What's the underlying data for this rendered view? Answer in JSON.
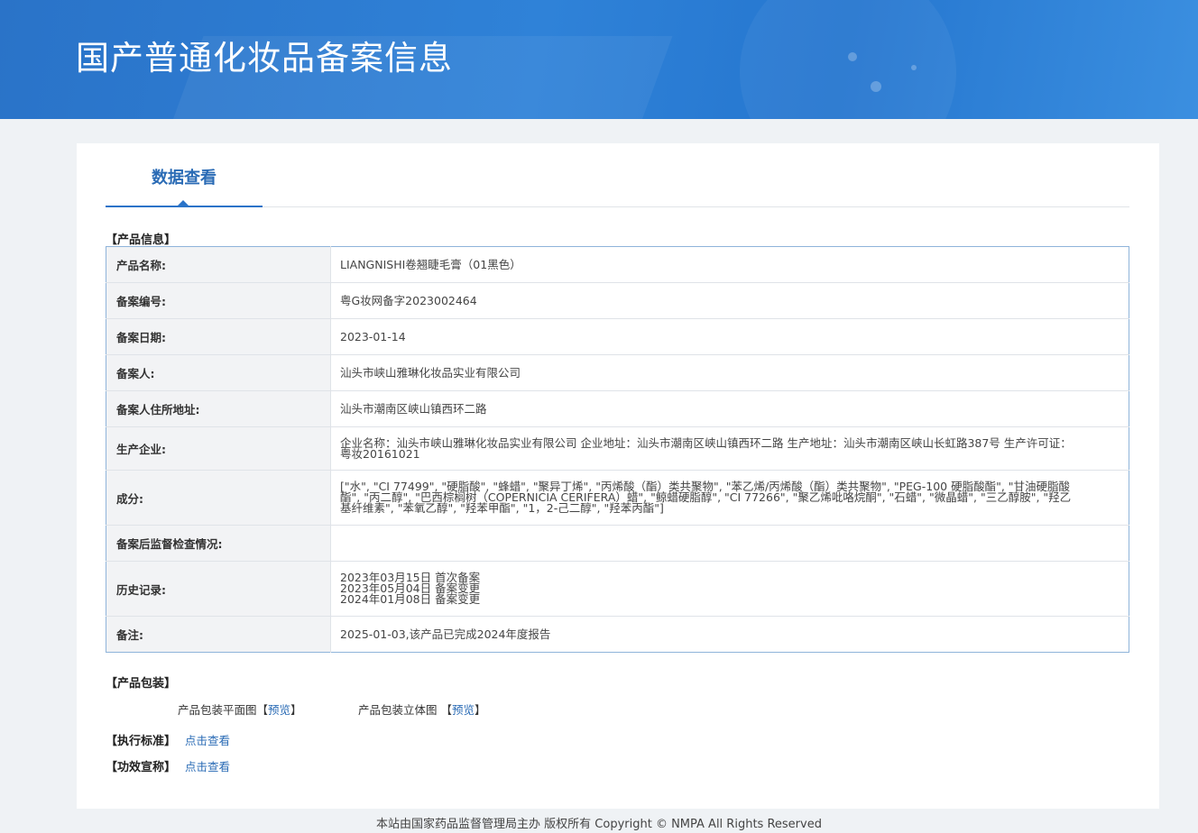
{
  "header": {
    "title": "国产普通化妆品备案信息"
  },
  "tab": {
    "label": "数据查看"
  },
  "product_info": {
    "section_label": "【产品信息】",
    "rows": [
      {
        "key": "产品名称:",
        "value": "LIANGNISHI卷翘睫毛膏（01黑色）"
      },
      {
        "key": "备案编号:",
        "value": "粤G妆网备字2023002464"
      },
      {
        "key": "备案日期:",
        "value": "2023-01-14"
      },
      {
        "key": "备案人:",
        "value": "汕头市峡山雅琳化妆品实业有限公司"
      },
      {
        "key": "备案人住所地址:",
        "value": "汕头市潮南区峡山镇西环二路"
      },
      {
        "key": "生产企业:",
        "value": "企业名称：汕头市峡山雅琳化妆品实业有限公司 企业地址：汕头市潮南区峡山镇西环二路 生产地址：汕头市潮南区峡山长虹路387号 生产许可证：粤妆20161021"
      },
      {
        "key": "成分:",
        "value": "[\"水\", \"CI 77499\", \"硬脂酸\", \"蜂蜡\", \"聚异丁烯\", \"丙烯酸（酯）类共聚物\", \"苯乙烯/丙烯酸（酯）类共聚物\", \"PEG-100 硬脂酸酯\", \"甘油硬脂酸酯\", \"丙二醇\", \"巴西棕榈树（COPERNICIA CERIFERA）蜡\", \"鲸蜡硬脂醇\", \"CI 77266\", \"聚乙烯吡咯烷酮\", \"石蜡\", \"微晶蜡\", \"三乙醇胺\", \"羟乙基纤维素\", \"苯氧乙醇\", \"羟苯甲酯\", \"1，2-己二醇\", \"羟苯丙酯\"]"
      },
      {
        "key": "备案后监督检查情况:",
        "value": ""
      },
      {
        "key": "历史记录:",
        "lines": [
          "2023年03月15日 首次备案",
          "2023年05月04日 备案变更",
          "2024年01月08日 备案变更"
        ]
      },
      {
        "key": "备注:",
        "value": "2025-01-03,该产品已完成2024年度报告"
      }
    ]
  },
  "packaging": {
    "section_label": "【产品包装】",
    "flat_label": "产品包装平面图",
    "stereo_label": "产品包装立体图",
    "bracket_open": "【",
    "bracket_close": "】",
    "preview_link": "预览"
  },
  "standard": {
    "label": "【执行标准】",
    "link": "点击查看"
  },
  "efficacy": {
    "label": "【功效宣称】",
    "link": "点击查看"
  },
  "footer": {
    "text": "本站由国家药品监督管理局主办 版权所有 Copyright © NMPA All Rights Reserved"
  }
}
